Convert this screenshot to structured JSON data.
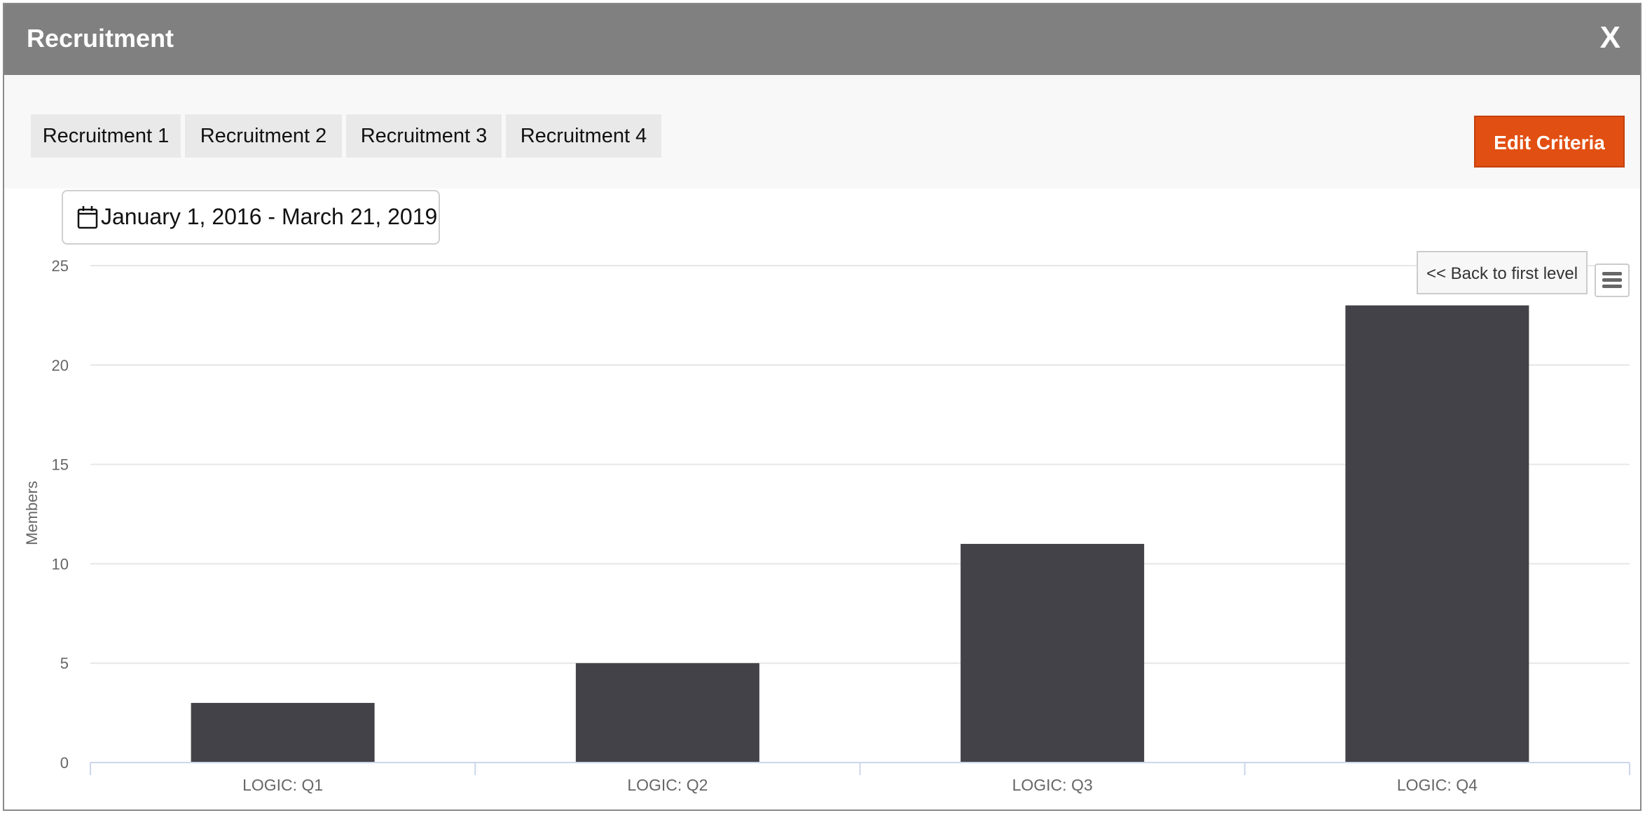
{
  "window": {
    "title": "Recruitment",
    "close_label": "X"
  },
  "tabs": [
    {
      "label": "Recruitment 1"
    },
    {
      "label": "Recruitment 2"
    },
    {
      "label": "Recruitment 3"
    },
    {
      "label": "Recruitment 4"
    }
  ],
  "toolbar": {
    "edit_label": "Edit Criteria"
  },
  "date_range": {
    "label": "January 1, 2016 - March 21, 2019",
    "icon": "calendar-icon"
  },
  "chart_controls": {
    "back_label": "<< Back to first level",
    "menu_icon": "hamburger-menu-icon"
  },
  "colors": {
    "bar": "#434248",
    "accent": "#e24f12",
    "header": "#808080"
  },
  "chart_data": {
    "type": "bar",
    "categories": [
      "LOGIC: Q1",
      "LOGIC: Q2",
      "LOGIC: Q3",
      "LOGIC: Q4"
    ],
    "values": [
      3,
      5,
      11,
      23
    ],
    "title": "",
    "xlabel": "",
    "ylabel": "Members",
    "ylim": [
      0,
      25
    ],
    "yticks": [
      0,
      5,
      10,
      15,
      20,
      25
    ],
    "grid": true,
    "legend": false
  }
}
